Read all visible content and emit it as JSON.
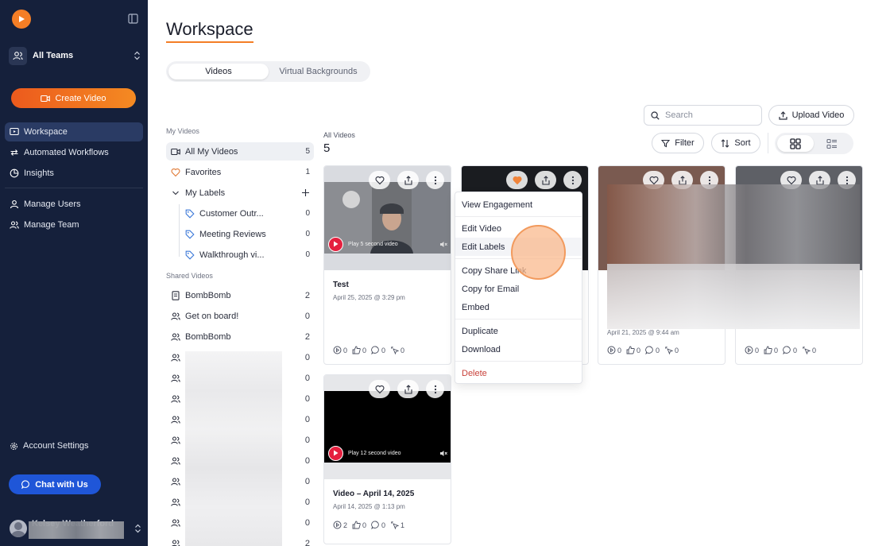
{
  "sidebar": {
    "team_label": "All Teams",
    "create_label": "Create Video",
    "nav": [
      {
        "label": "Workspace",
        "icon": "video-screen-icon",
        "active": true
      },
      {
        "label": "Automated Workflows",
        "icon": "repeat-arrows-icon",
        "active": false
      },
      {
        "label": "Insights",
        "icon": "pie-chart-icon",
        "active": false
      }
    ],
    "nav2": [
      {
        "label": "Manage Users",
        "icon": "user-icon"
      },
      {
        "label": "Manage Team",
        "icon": "users-icon"
      }
    ],
    "account_settings": "Account Settings",
    "chat_label": "Chat with Us",
    "user_name": "Kelsey Weatherford"
  },
  "header": {
    "title": "Workspace",
    "tabs": [
      "Videos",
      "Virtual Backgrounds"
    ]
  },
  "toolbar": {
    "search_placeholder": "Search",
    "upload_label": "Upload Video",
    "filter_label": "Filter",
    "sort_label": "Sort"
  },
  "folders": {
    "my_videos_heading": "My Videos",
    "all_my_videos": {
      "label": "All My Videos",
      "count": "5"
    },
    "favorites": {
      "label": "Favorites",
      "count": "1"
    },
    "my_labels": "My Labels",
    "labels": [
      {
        "label": "Customer Outr...",
        "count": "0"
      },
      {
        "label": "Meeting Reviews",
        "count": "0"
      },
      {
        "label": "Walkthrough vi...",
        "count": "0"
      }
    ],
    "shared_heading": "Shared Videos",
    "shared": [
      {
        "label": "BombBomb",
        "count": "2",
        "icon": "document-icon"
      },
      {
        "label": "Get on board!",
        "count": "0",
        "icon": "users-icon"
      },
      {
        "label": "BombBomb",
        "count": "2",
        "icon": "users-icon"
      },
      {
        "label": "",
        "count": "0",
        "icon": "users-icon"
      },
      {
        "label": "",
        "count": "0",
        "icon": "users-icon"
      },
      {
        "label": "",
        "count": "0",
        "icon": "users-icon"
      },
      {
        "label": "",
        "count": "0",
        "icon": "users-icon"
      },
      {
        "label": "",
        "count": "0",
        "icon": "users-icon"
      },
      {
        "label": "",
        "count": "0",
        "icon": "users-icon"
      },
      {
        "label": "",
        "count": "0",
        "icon": "users-icon"
      },
      {
        "label": "",
        "count": "0",
        "icon": "users-icon"
      },
      {
        "label": "",
        "count": "0",
        "icon": "users-icon"
      },
      {
        "label": "",
        "count": "2",
        "icon": "users-icon"
      }
    ]
  },
  "grid": {
    "heading": "All Videos",
    "count": "5",
    "cards": [
      {
        "title": "Test",
        "date": "April 25, 2025 @ 3:29 pm",
        "play_text": "Play 5 second video",
        "views": "0",
        "likes": "0",
        "comments": "0",
        "clicks": "0",
        "favorite": false
      },
      {
        "title": "",
        "date": "",
        "play_text": "",
        "views": "",
        "likes": "",
        "comments": "",
        "clicks": "",
        "favorite": true
      },
      {
        "title": "",
        "date": "April 21, 2025 @ 9:44 am",
        "play_text": "",
        "views": "0",
        "likes": "0",
        "comments": "0",
        "clicks": "0",
        "favorite": false
      },
      {
        "title": "",
        "date": "",
        "play_text": "",
        "views": "0",
        "likes": "0",
        "comments": "0",
        "clicks": "0",
        "favorite": false
      },
      {
        "title": "Video – April 14, 2025",
        "date": "April 14, 2025 @ 1:13 pm",
        "play_text": "Play 12 second video",
        "views": "2",
        "likes": "0",
        "comments": "0",
        "clicks": "1",
        "favorite": false
      }
    ]
  },
  "context_menu": {
    "items": [
      "View Engagement",
      "Edit Video",
      "Edit Labels",
      "Copy Share Link",
      "Copy for Email",
      "Embed",
      "Duplicate",
      "Download",
      "Delete"
    ]
  },
  "colors": {
    "sidebar_bg": "#15203b",
    "accent_orange": "#f47e26",
    "chat_blue": "#1f56d8",
    "play_red": "#e5203f",
    "danger": "#c8413a"
  }
}
